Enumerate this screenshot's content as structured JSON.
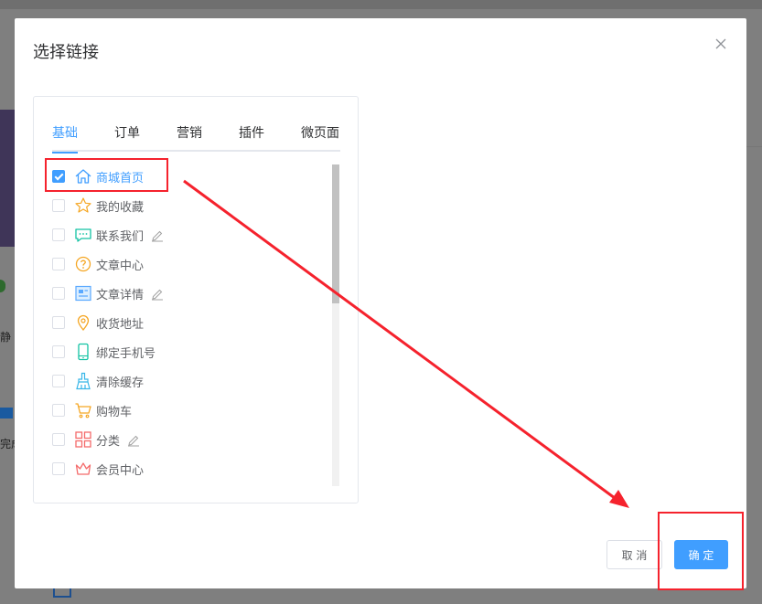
{
  "dialog": {
    "title": "选择链接"
  },
  "tabs": [
    {
      "label": "基础",
      "active": true
    },
    {
      "label": "订单",
      "active": false
    },
    {
      "label": "营销",
      "active": false
    },
    {
      "label": "插件",
      "active": false
    },
    {
      "label": "微页面",
      "active": false
    }
  ],
  "links": [
    {
      "label": "商城首页",
      "icon": "home-icon",
      "checked": true,
      "editable": false
    },
    {
      "label": "我的收藏",
      "icon": "star-icon",
      "checked": false,
      "editable": false
    },
    {
      "label": "联系我们",
      "icon": "chat-icon",
      "checked": false,
      "editable": true
    },
    {
      "label": "文章中心",
      "icon": "question-icon",
      "checked": false,
      "editable": false
    },
    {
      "label": "文章详情",
      "icon": "article-icon",
      "checked": false,
      "editable": true
    },
    {
      "label": "收货地址",
      "icon": "location-icon",
      "checked": false,
      "editable": false
    },
    {
      "label": "绑定手机号",
      "icon": "phone-icon",
      "checked": false,
      "editable": false
    },
    {
      "label": "清除缓存",
      "icon": "broom-icon",
      "checked": false,
      "editable": false
    },
    {
      "label": "购物车",
      "icon": "cart-icon",
      "checked": false,
      "editable": false
    },
    {
      "label": "分类",
      "icon": "grid-icon",
      "checked": false,
      "editable": true
    },
    {
      "label": "会员中心",
      "icon": "crown-icon",
      "checked": false,
      "editable": false
    }
  ],
  "buttons": {
    "cancel": "取 消",
    "ok": "确 定"
  },
  "background": {
    "sidebar_text_1": "静",
    "sidebar_text_2": "完成"
  },
  "colors": {
    "primary": "#409eff",
    "annotation": "#f5222d"
  }
}
